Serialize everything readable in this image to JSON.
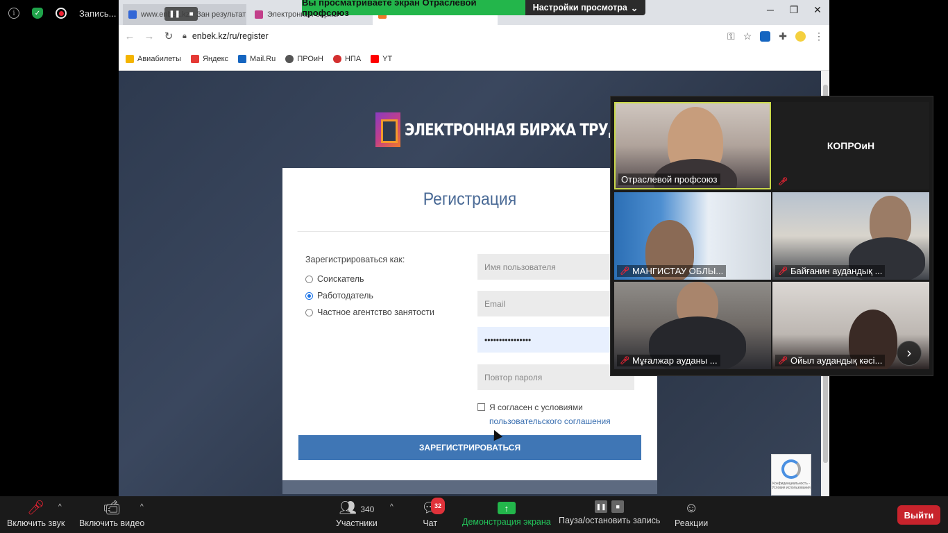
{
  "zoom": {
    "recording_label": "Запись...",
    "share_banner": "Вы просматриваете экран Отраслевой профсоюз",
    "view_options": "Настройки просмотра",
    "participants_count": "340",
    "chat_badge": "32",
    "toolbar": {
      "audio": "Включить звук",
      "video": "Включить видео",
      "participants": "Участники",
      "chat": "Чат",
      "share": "Демонстрация экрана",
      "record": "Пауза/остановить запись",
      "reactions": "Реакции",
      "exit": "Выйти"
    },
    "gallery": [
      {
        "name": "Отраслевой профсоюз",
        "muted": false
      },
      {
        "name": "КОПРОиН",
        "muted": true
      },
      {
        "name": "МАНГИСТАУ ОБЛЫ...",
        "muted": true
      },
      {
        "name": "Байғанин аудандық ...",
        "muted": true
      },
      {
        "name": "Мұғалжар ауданы ...",
        "muted": true
      },
      {
        "name": "Ойыл аудандық кәсі...",
        "muted": true
      }
    ]
  },
  "browser": {
    "tabs": [
      {
        "title": "www.enbek.kz - Зан результаты",
        "favicon_color": "#3367d6"
      },
      {
        "title": "Электронная биржа",
        "favicon_color": "#c23f8a"
      },
      {
        "title": "",
        "favicon_color": "#f07a28"
      }
    ],
    "url": "enbek.kz/ru/register",
    "bookmarks": [
      {
        "label": "Авиабилеты",
        "icon_color": "#f4b400"
      },
      {
        "label": "Яндекс",
        "icon_color": "#e53935"
      },
      {
        "label": "Mail.Ru",
        "icon_color": "#1565c0"
      },
      {
        "label": "ПРОиН",
        "icon_color": "#555555"
      },
      {
        "label": "НПА",
        "icon_color": "#d32f2f"
      },
      {
        "label": "YT",
        "icon_color": "#ff0000"
      }
    ]
  },
  "page": {
    "logo_text": "ЭЛЕКТРОННАЯ БИРЖА ТРУДА",
    "title": "Регистрация",
    "register_as": "Зарегистрироваться как:",
    "roles": [
      {
        "label": "Соискатель",
        "selected": false
      },
      {
        "label": "Работодатель",
        "selected": true
      },
      {
        "label": "Частное агентство занятости",
        "selected": false
      }
    ],
    "fields": {
      "username_placeholder": "Имя пользователя",
      "email_placeholder": "Email",
      "password_value": "••••••••••••••••",
      "password_repeat_placeholder": "Повтор пароля"
    },
    "agree_text": "Я согласен с условиями",
    "agree_link": "пользовательского соглашения",
    "submit": "ЗАРЕГИСТРИРОВАТЬСЯ",
    "recaptcha_text": "Конфиденциальность - Условия использования"
  }
}
